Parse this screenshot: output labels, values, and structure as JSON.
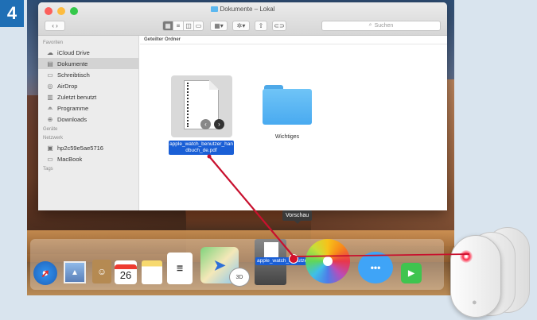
{
  "step": {
    "number": "4",
    "color": "#1f6fb5"
  },
  "window": {
    "title": "Dokumente – Lokal",
    "search_placeholder": "Suchen",
    "content_header": "Geteilter Ordner"
  },
  "sidebar": {
    "favorites_label": "Favoriten",
    "favorites": [
      {
        "label": "iCloud Drive",
        "icon": "cloud-icon"
      },
      {
        "label": "Dokumente",
        "icon": "document-icon",
        "active": true
      },
      {
        "label": "Schreibtisch",
        "icon": "desktop-icon"
      },
      {
        "label": "AirDrop",
        "icon": "airdrop-icon"
      },
      {
        "label": "Zuletzt benutzt",
        "icon": "recent-icon"
      },
      {
        "label": "Programme",
        "icon": "apps-icon"
      },
      {
        "label": "Downloads",
        "icon": "download-icon"
      }
    ],
    "devices_label": "Geräte",
    "network_label": "Netzwerk",
    "network": [
      {
        "label": "hp2c59e5ae5716",
        "icon": "printer-icon"
      },
      {
        "label": "MacBook",
        "icon": "laptop-icon"
      }
    ],
    "tags_label": "Tags"
  },
  "files": {
    "pdf_name": "apple_watch_benutzer_handbuch_de.pdf",
    "folder_name": "Wichtiges"
  },
  "dock": {
    "tooltip": "Vorschau",
    "drag_label": "apple_watch_benutzer_han...ch_de.pdf",
    "calendar_day": "26",
    "maps_3d": "3D"
  },
  "colors": {
    "selection": "#1a5fd6",
    "annotation_line": "#c8102e",
    "folder": "#5cb8f0"
  }
}
